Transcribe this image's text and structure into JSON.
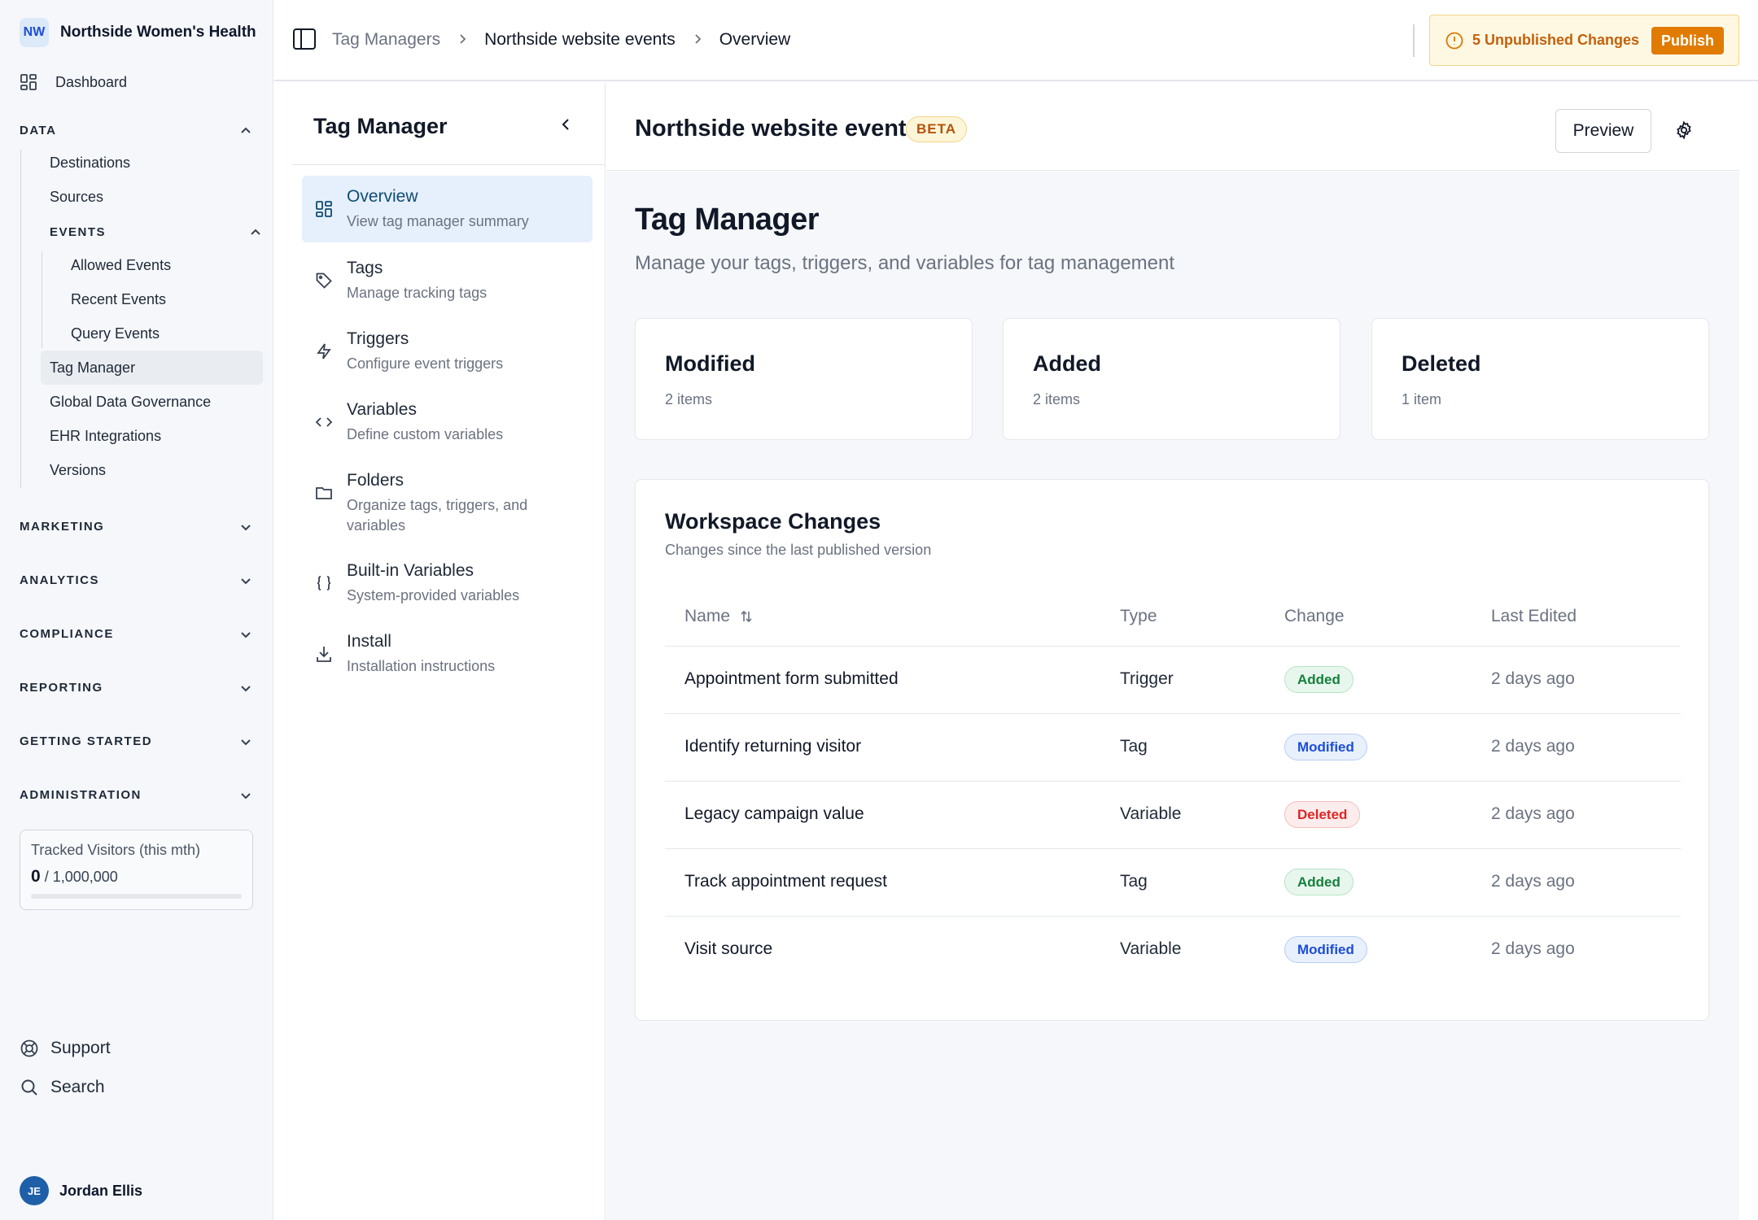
{
  "org": {
    "initials": "NW",
    "name": "Northside Women's Health"
  },
  "sidebar": {
    "dashboard_label": "Dashboard",
    "data_section": "DATA",
    "data_items": [
      "Destinations",
      "Sources"
    ],
    "events_section": "EVENTS",
    "events_items": [
      "Allowed Events",
      "Recent Events",
      "Query Events"
    ],
    "data_items_after": [
      "Tag Manager",
      "Global Data Governance",
      "EHR Integrations",
      "Versions"
    ],
    "sections": [
      "MARKETING",
      "ANALYTICS",
      "COMPLIANCE",
      "REPORTING",
      "GETTING STARTED",
      "ADMINISTRATION"
    ],
    "usage": {
      "label": "Tracked Visitors (this mth)",
      "value": "0",
      "limit": "/ 1,000,000",
      "fraction": 0
    },
    "support_label": "Support",
    "search_label": "Search",
    "user": {
      "initials": "JE",
      "name": "Jordan Ellis"
    }
  },
  "header": {
    "breadcrumbs": [
      "Tag Managers",
      "Northside website events",
      "Overview"
    ],
    "unpublished_label": "5 Unpublished Changes",
    "publish_label": "Publish"
  },
  "tm_panel": {
    "title": "Tag Manager",
    "items": [
      {
        "title": "Overview",
        "sub": "View tag manager summary",
        "icon": "grid-icon"
      },
      {
        "title": "Tags",
        "sub": "Manage tracking tags",
        "icon": "tag-icon"
      },
      {
        "title": "Triggers",
        "sub": "Configure event triggers",
        "icon": "bolt-icon"
      },
      {
        "title": "Variables",
        "sub": "Define custom variables",
        "icon": "code-icon"
      },
      {
        "title": "Folders",
        "sub": "Organize tags, triggers, and variables",
        "icon": "folder-icon"
      },
      {
        "title": "Built-in Variables",
        "sub": "System-provided variables",
        "icon": "braces-icon"
      },
      {
        "title": "Install",
        "sub": "Installation instructions",
        "icon": "download-icon"
      }
    ]
  },
  "main": {
    "title": "Northside website events",
    "beta": "BETA",
    "preview_label": "Preview",
    "page_title": "Tag Manager",
    "page_sub": "Manage your tags, triggers, and variables for tag management",
    "stats": [
      {
        "title": "Modified",
        "count": "2 items"
      },
      {
        "title": "Added",
        "count": "2 items"
      },
      {
        "title": "Deleted",
        "count": "1 item"
      }
    ],
    "workspace": {
      "title": "Workspace Changes",
      "sub": "Changes since the last published version",
      "columns": [
        "Name",
        "Type",
        "Change",
        "Last Edited"
      ],
      "rows": [
        {
          "name": "Appointment form submitted",
          "type": "Trigger",
          "change": "Added",
          "edited": "2 days ago"
        },
        {
          "name": "Identify returning visitor",
          "type": "Tag",
          "change": "Modified",
          "edited": "2 days ago"
        },
        {
          "name": "Legacy campaign value",
          "type": "Variable",
          "change": "Deleted",
          "edited": "2 days ago"
        },
        {
          "name": "Track appointment request",
          "type": "Tag",
          "change": "Added",
          "edited": "2 days ago"
        },
        {
          "name": "Visit source",
          "type": "Variable",
          "change": "Modified",
          "edited": "2 days ago"
        }
      ]
    }
  },
  "colors": {
    "accent": "#e07b00",
    "active_nav": "#e6effc",
    "added": "#15803d",
    "modified": "#1d4ed8",
    "deleted": "#dc2626"
  }
}
